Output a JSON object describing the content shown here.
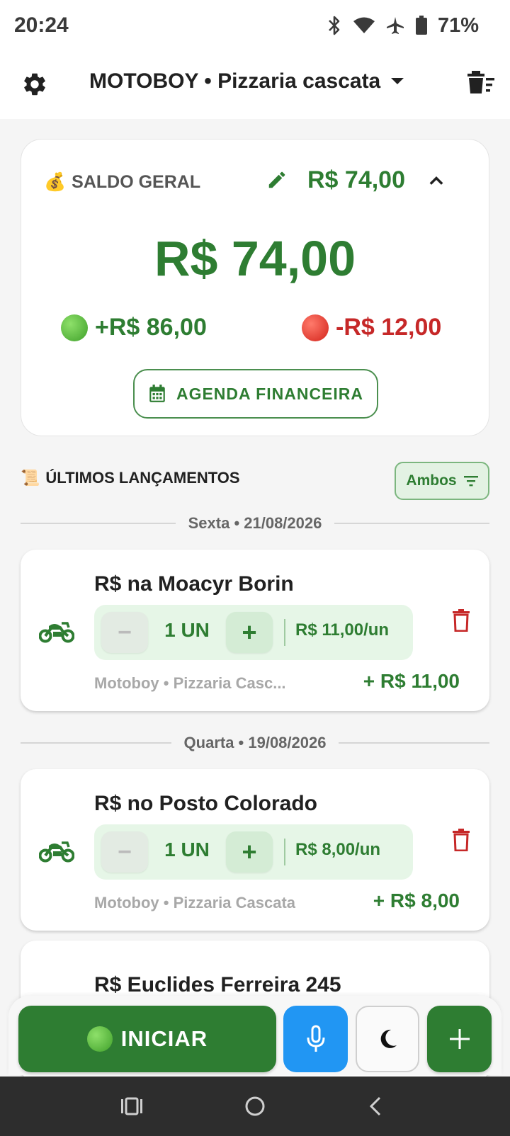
{
  "status_bar": {
    "time": "20:24",
    "battery": "71%"
  },
  "app_bar": {
    "title": "MOTOBOY • Pizzaria cascata"
  },
  "balance": {
    "emoji": "💰",
    "header_label": "SALDO GERAL",
    "header_value": "R$ 74,00",
    "total": "R$ 74,00",
    "income": "+R$ 86,00",
    "expense": "-R$ 12,00",
    "agenda_button": "AGENDA FINANCEIRA"
  },
  "entries_section": {
    "emoji": "📜",
    "title": "ÚLTIMOS LANÇAMENTOS",
    "filter": "Ambos"
  },
  "groups": [
    {
      "date": "Sexta • 21/08/2026",
      "entries": [
        {
          "title": "R$ na Moacyr Borin",
          "qty": "1 UN",
          "minus": "−",
          "plus": "+",
          "unit_price": "R$ 11,00/un",
          "meta": "Motoboy • Pizzaria Casc...",
          "total": "+ R$ 11,00"
        }
      ]
    },
    {
      "date": "Quarta • 19/08/2026",
      "entries": [
        {
          "title": "R$ no Posto Colorado",
          "qty": "1 UN",
          "minus": "−",
          "plus": "+",
          "unit_price": "R$ 8,00/un",
          "meta": "Motoboy • Pizzaria Cascata",
          "total": "+ R$ 8,00"
        },
        {
          "title": "R$ Euclides Ferreira 245"
        }
      ]
    }
  ],
  "bottom_actions": {
    "start_label": "INICIAR"
  },
  "colors": {
    "primary_green": "#2e7d32",
    "expense_red": "#c62828",
    "mic_blue": "#2196f3",
    "nav_dark": "#2d2d2d"
  },
  "icons": [
    "bluetooth-icon",
    "wifi-icon",
    "airplane-icon",
    "battery-icon",
    "gear-icon",
    "dropdown-arrow-icon",
    "delete-sweep-icon",
    "pencil-icon",
    "chevron-up-icon",
    "calendar-icon",
    "filter-icon",
    "motorcycle-icon",
    "trash-icon",
    "mic-icon",
    "moon-icon",
    "plus-icon",
    "recents-icon",
    "home-icon",
    "back-icon"
  ]
}
